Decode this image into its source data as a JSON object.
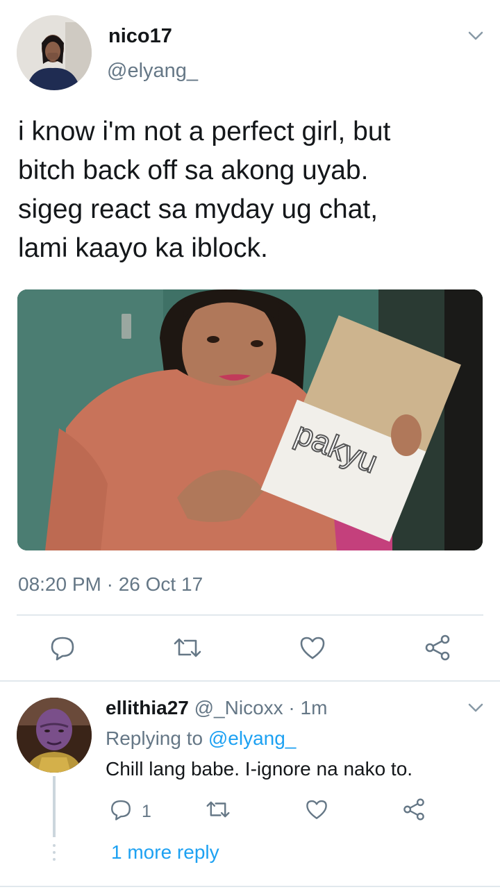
{
  "tweet": {
    "display_name": "nico17",
    "handle": "@elyang_",
    "text": "i know i'm not a perfect girl, but\nbitch back off sa akong uyab.\nsigeg react sa myday ug chat,\nlami kaayo ka iblock.",
    "media_sign_text": "pakyu",
    "timestamp": "08:20 PM · 26 Oct 17",
    "actions": [
      "reply-icon",
      "retweet-icon",
      "like-icon",
      "share-icon"
    ]
  },
  "reply": {
    "display_name": "ellithia27",
    "handle": "@_Nicoxx",
    "separator": " · ",
    "time": "1m",
    "replying_prefix": "Replying to ",
    "replying_handle": "@elyang_",
    "text": "Chill lang babe. I-ignore na nako to.",
    "reply_count": "1",
    "more_replies": "1 more reply"
  },
  "colors": {
    "primary_text": "#14171a",
    "secondary_text": "#657786",
    "link": "#1da1f2",
    "divider": "#e1e8ed",
    "icon": "#657786"
  }
}
